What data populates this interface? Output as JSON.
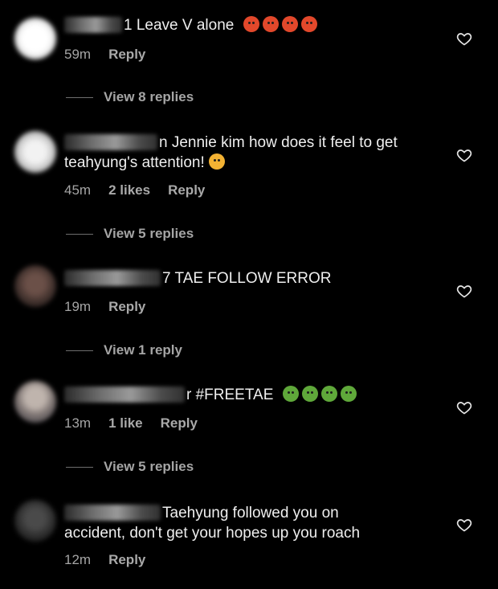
{
  "comments": [
    {
      "text": "1 Leave V alone",
      "emoji": "angry-face-emoji",
      "emoji_count": 4,
      "time": "59m",
      "likes": "",
      "reply_label": "Reply",
      "view_replies": "View 8 replies"
    },
    {
      "text_line1": "n Jennie kim how does it feel to get",
      "text_line2": "teahyung's attention!",
      "emoji": "upside-down-face-emoji",
      "time": "45m",
      "likes": "2 likes",
      "reply_label": "Reply",
      "view_replies": "View 5 replies"
    },
    {
      "text": "7 TAE FOLLOW ERROR",
      "time": "19m",
      "likes": "",
      "reply_label": "Reply",
      "view_replies": "View 1 reply"
    },
    {
      "text": "r #FREETAE",
      "emoji": "nauseated-face-emoji",
      "emoji_count": 4,
      "time": "13m",
      "likes": "1 like",
      "reply_label": "Reply",
      "view_replies": "View 5 replies"
    },
    {
      "text_line1": "Taehyung followed you on",
      "text_line2": "accident, don't get your hopes up you roach",
      "time": "12m",
      "likes": "",
      "reply_label": "Reply"
    }
  ],
  "icons": {
    "like": "heart-outline-icon"
  },
  "colors": {
    "background": "#000000",
    "text": "#efefef",
    "meta": "#a5a5a5"
  }
}
